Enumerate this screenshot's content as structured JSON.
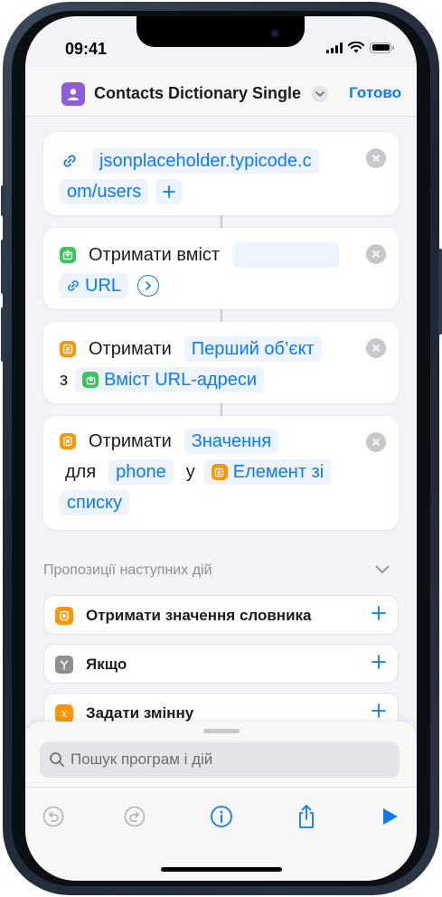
{
  "status": {
    "time": "09:41"
  },
  "header": {
    "title": "Contacts Dictionary Single",
    "done": "Готово"
  },
  "actions": {
    "url": {
      "text1": "jsonplaceholder.typicode.c",
      "text2": "om/users"
    },
    "get_contents": {
      "label": "Отримати вміст",
      "param": "URL"
    },
    "get_item": {
      "verb": "Отримати",
      "value": "Перший об’єкт",
      "from": "з",
      "source": "Вміст URL-адреси"
    },
    "get_value": {
      "verb": "Отримати",
      "value": "Значення",
      "for": "для",
      "key": "phone",
      "in": "у",
      "dict1": "Елемент зі",
      "dict2": "списку"
    }
  },
  "suggestions": {
    "heading": "Пропозиції наступних дій",
    "items": [
      {
        "label": "Отримати значення словника",
        "color": "#ff9500"
      },
      {
        "label": "Якщо",
        "color": "#8e8e93"
      },
      {
        "label": "Задати змінну",
        "color": "#ff9500"
      }
    ]
  },
  "search": {
    "placeholder": "Пошук програм і дій"
  },
  "colors": {
    "accent": "#0a7aff",
    "app_icon": "#8e5cd9",
    "green": "#34c759",
    "orange": "#ff9500"
  }
}
